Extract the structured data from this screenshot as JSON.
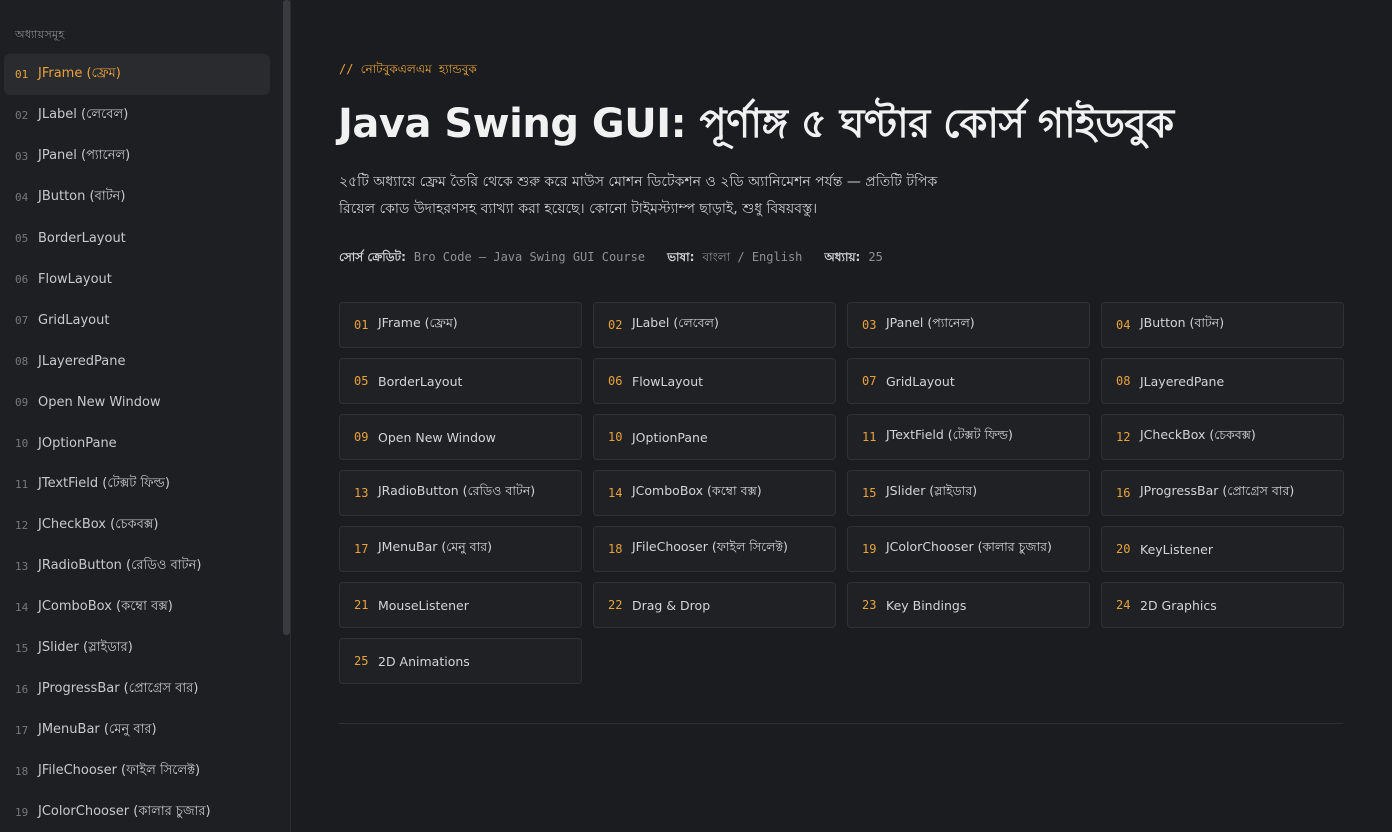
{
  "sidebar": {
    "heading": "অধ্যায়সমূহ",
    "items": [
      {
        "num": "01",
        "label": "JFrame (ফ্রেম)"
      },
      {
        "num": "02",
        "label": "JLabel (লেবেল)"
      },
      {
        "num": "03",
        "label": "JPanel (প্যানেল)"
      },
      {
        "num": "04",
        "label": "JButton (বাটন)"
      },
      {
        "num": "05",
        "label": "BorderLayout"
      },
      {
        "num": "06",
        "label": "FlowLayout"
      },
      {
        "num": "07",
        "label": "GridLayout"
      },
      {
        "num": "08",
        "label": "JLayeredPane"
      },
      {
        "num": "09",
        "label": "Open New Window"
      },
      {
        "num": "10",
        "label": "JOptionPane"
      },
      {
        "num": "11",
        "label": "JTextField (টেক্সট ফিল্ড)"
      },
      {
        "num": "12",
        "label": "JCheckBox (চেকবক্স)"
      },
      {
        "num": "13",
        "label": "JRadioButton (রেডিও বাটন)"
      },
      {
        "num": "14",
        "label": "JComboBox (কম্বো বক্স)"
      },
      {
        "num": "15",
        "label": "JSlider (স্লাইডার)"
      },
      {
        "num": "16",
        "label": "JProgressBar (প্রোগ্রেস বার)"
      },
      {
        "num": "17",
        "label": "JMenuBar (মেনু বার)"
      },
      {
        "num": "18",
        "label": "JFileChooser (ফাইল সিলেক্ট)"
      },
      {
        "num": "19",
        "label": "JColorChooser (কালার চুজার)"
      }
    ]
  },
  "header": {
    "eyebrow": "// নোটবুকএলএম হ্যান্ডবুক",
    "title": "Java Swing GUI: পূর্ণাঙ্গ ৫ ঘণ্টার কোর্স গাইডবুক",
    "desc_line1": "২৫টি অধ্যায়ে ফ্রেম তৈরি থেকে শুরু করে মাউস মোশন ডিটেকশন ও ২ডি অ্যানিমেশন পর্যন্ত — প্রতিটি টপিক",
    "desc_line2": "রিয়েল কোড উদাহরণসহ ব্যাখ্যা করা হয়েছে। কোনো টাইমস্ট্যাম্প ছাড়াই, শুধু বিষয়বস্তু।"
  },
  "meta": {
    "source_label": "সোর্স ক্রেডিট:",
    "source_value": "Bro Code — Java Swing GUI Course",
    "lang_label": "ভাষা:",
    "lang_value": "বাংলা / English",
    "chapters_label": "অধ্যায়:",
    "chapters_value": "25"
  },
  "chapters": [
    {
      "num": "01",
      "label": "JFrame (ফ্রেম)"
    },
    {
      "num": "02",
      "label": "JLabel (লেবেল)"
    },
    {
      "num": "03",
      "label": "JPanel (প্যানেল)"
    },
    {
      "num": "04",
      "label": "JButton (বাটন)"
    },
    {
      "num": "05",
      "label": "BorderLayout"
    },
    {
      "num": "06",
      "label": "FlowLayout"
    },
    {
      "num": "07",
      "label": "GridLayout"
    },
    {
      "num": "08",
      "label": "JLayeredPane"
    },
    {
      "num": "09",
      "label": "Open New Window"
    },
    {
      "num": "10",
      "label": "JOptionPane"
    },
    {
      "num": "11",
      "label": "JTextField (টেক্সট ফিল্ড)"
    },
    {
      "num": "12",
      "label": "JCheckBox (চেকবক্স)"
    },
    {
      "num": "13",
      "label": "JRadioButton (রেডিও বাটন)"
    },
    {
      "num": "14",
      "label": "JComboBox (কম্বো বক্স)"
    },
    {
      "num": "15",
      "label": "JSlider (স্লাইডার)"
    },
    {
      "num": "16",
      "label": "JProgressBar (প্রোগ্রেস বার)"
    },
    {
      "num": "17",
      "label": "JMenuBar (মেনু বার)"
    },
    {
      "num": "18",
      "label": "JFileChooser (ফাইল সিলেক্ট)"
    },
    {
      "num": "19",
      "label": "JColorChooser (কালার চুজার)"
    },
    {
      "num": "20",
      "label": "KeyListener"
    },
    {
      "num": "21",
      "label": "MouseListener"
    },
    {
      "num": "22",
      "label": "Drag & Drop"
    },
    {
      "num": "23",
      "label": "Key Bindings"
    },
    {
      "num": "24",
      "label": "2D Graphics"
    },
    {
      "num": "25",
      "label": "2D Animations"
    }
  ],
  "colors": {
    "accent": "#e8a23b",
    "background": "#1b1c1f",
    "sidebar": "#1e1f22",
    "card": "#202124"
  }
}
